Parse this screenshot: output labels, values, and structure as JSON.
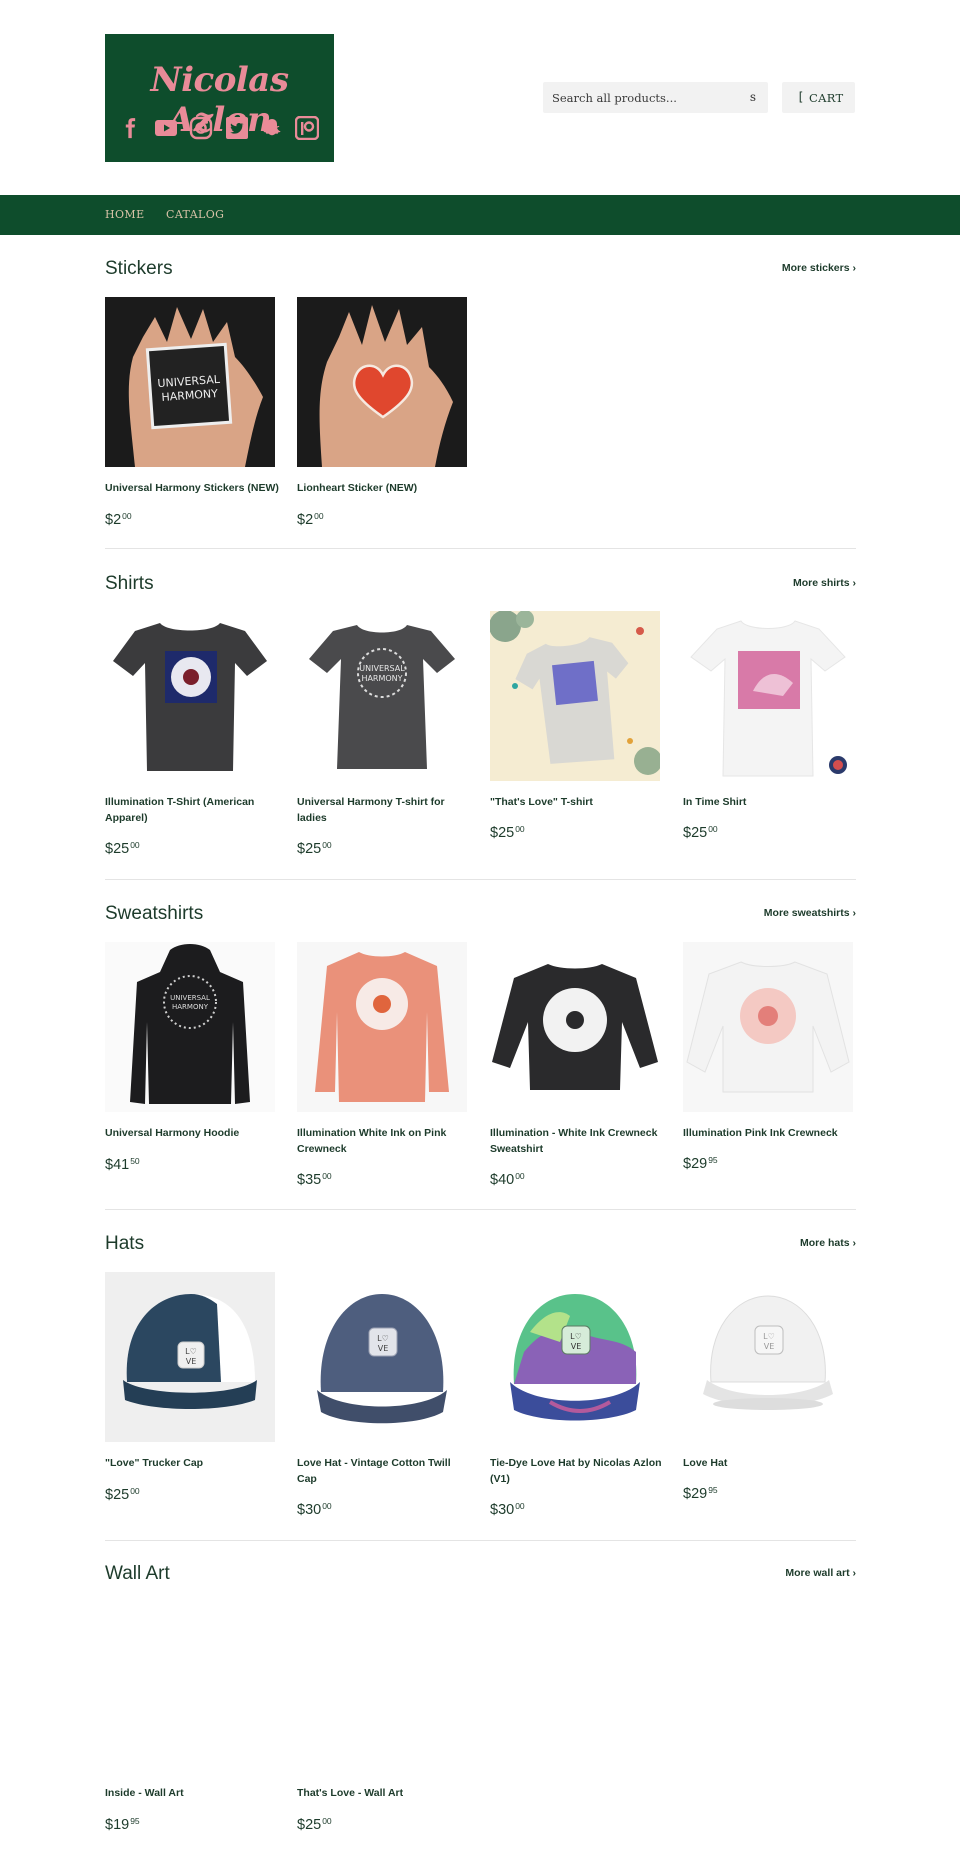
{
  "header": {
    "logo_text": "Nicolas Azlon",
    "logo_icons": [
      "facebook-icon",
      "youtube-icon",
      "instagram-icon",
      "twitter-icon",
      "snapchat-icon",
      "patreon-icon"
    ],
    "search_placeholder": "Search all products...",
    "search_button": "s",
    "cart_icon": "[",
    "cart_label": "CART"
  },
  "nav": {
    "items": [
      "HOME",
      "CATALOG"
    ]
  },
  "colors": {
    "brand_green": "#0e4d2c",
    "logo_pink": "#e98b98",
    "nav_text": "#d7c2a7",
    "text": "#1d3b2b"
  },
  "sections": [
    {
      "title": "Stickers",
      "more": "More stickers ›",
      "products": [
        {
          "name": "Universal Harmony Stickers (NEW)",
          "price_main": "$2",
          "price_cents": "00",
          "image": "hand-holding-sticker"
        },
        {
          "name": "Lionheart Sticker (NEW)",
          "price_main": "$2",
          "price_cents": "00",
          "image": "hand-holding-heart-sticker"
        }
      ]
    },
    {
      "title": "Shirts",
      "more": "More shirts ›",
      "products": [
        {
          "name": "Illumination T-Shirt (American Apparel)",
          "price_main": "$25",
          "price_cents": "00",
          "image": "dark-tshirt-blue-print"
        },
        {
          "name": "Universal Harmony T-shirt for ladies",
          "price_main": "$25",
          "price_cents": "00",
          "image": "dark-tshirt-white-print"
        },
        {
          "name": "\"That's Love\" T-shirt",
          "price_main": "$25",
          "price_cents": "00",
          "image": "grey-tshirt-flatlay"
        },
        {
          "name": "In Time Shirt",
          "price_main": "$25",
          "price_cents": "00",
          "image": "white-tshirt-pink-print"
        }
      ]
    },
    {
      "title": "Sweatshirts",
      "more": "More sweatshirts ›",
      "products": [
        {
          "name": "Universal Harmony Hoodie",
          "price_main": "$41",
          "price_cents": "50",
          "image": "black-hoodie"
        },
        {
          "name": "Illumination White Ink on Pink Crewneck",
          "price_main": "$35",
          "price_cents": "00",
          "image": "pink-crewneck"
        },
        {
          "name": "Illumination - White Ink Crewneck Sweatshirt",
          "price_main": "$40",
          "price_cents": "00",
          "image": "black-crewneck"
        },
        {
          "name": "Illumination Pink Ink Crewneck",
          "price_main": "$29",
          "price_cents": "95",
          "image": "white-crewneck"
        }
      ]
    },
    {
      "title": "Hats",
      "more": "More hats ›",
      "products": [
        {
          "name": "\"Love\" Trucker Cap",
          "price_main": "$25",
          "price_cents": "00",
          "image": "navy-trucker-cap"
        },
        {
          "name": "Love Hat - Vintage Cotton Twill Cap",
          "price_main": "$30",
          "price_cents": "00",
          "image": "denim-cap"
        },
        {
          "name": "Tie-Dye Love Hat by Nicolas Azlon (V1)",
          "price_main": "$30",
          "price_cents": "00",
          "image": "tie-dye-cap"
        },
        {
          "name": "Love Hat",
          "price_main": "$29",
          "price_cents": "95",
          "image": "white-cap"
        }
      ]
    },
    {
      "title": "Wall Art",
      "more": "More wall art ›",
      "products": [
        {
          "name": "Inside - Wall Art",
          "price_main": "$19",
          "price_cents": "95",
          "image": "blank"
        },
        {
          "name": "That's Love - Wall Art",
          "price_main": "$25",
          "price_cents": "00",
          "image": "blank"
        }
      ]
    }
  ]
}
